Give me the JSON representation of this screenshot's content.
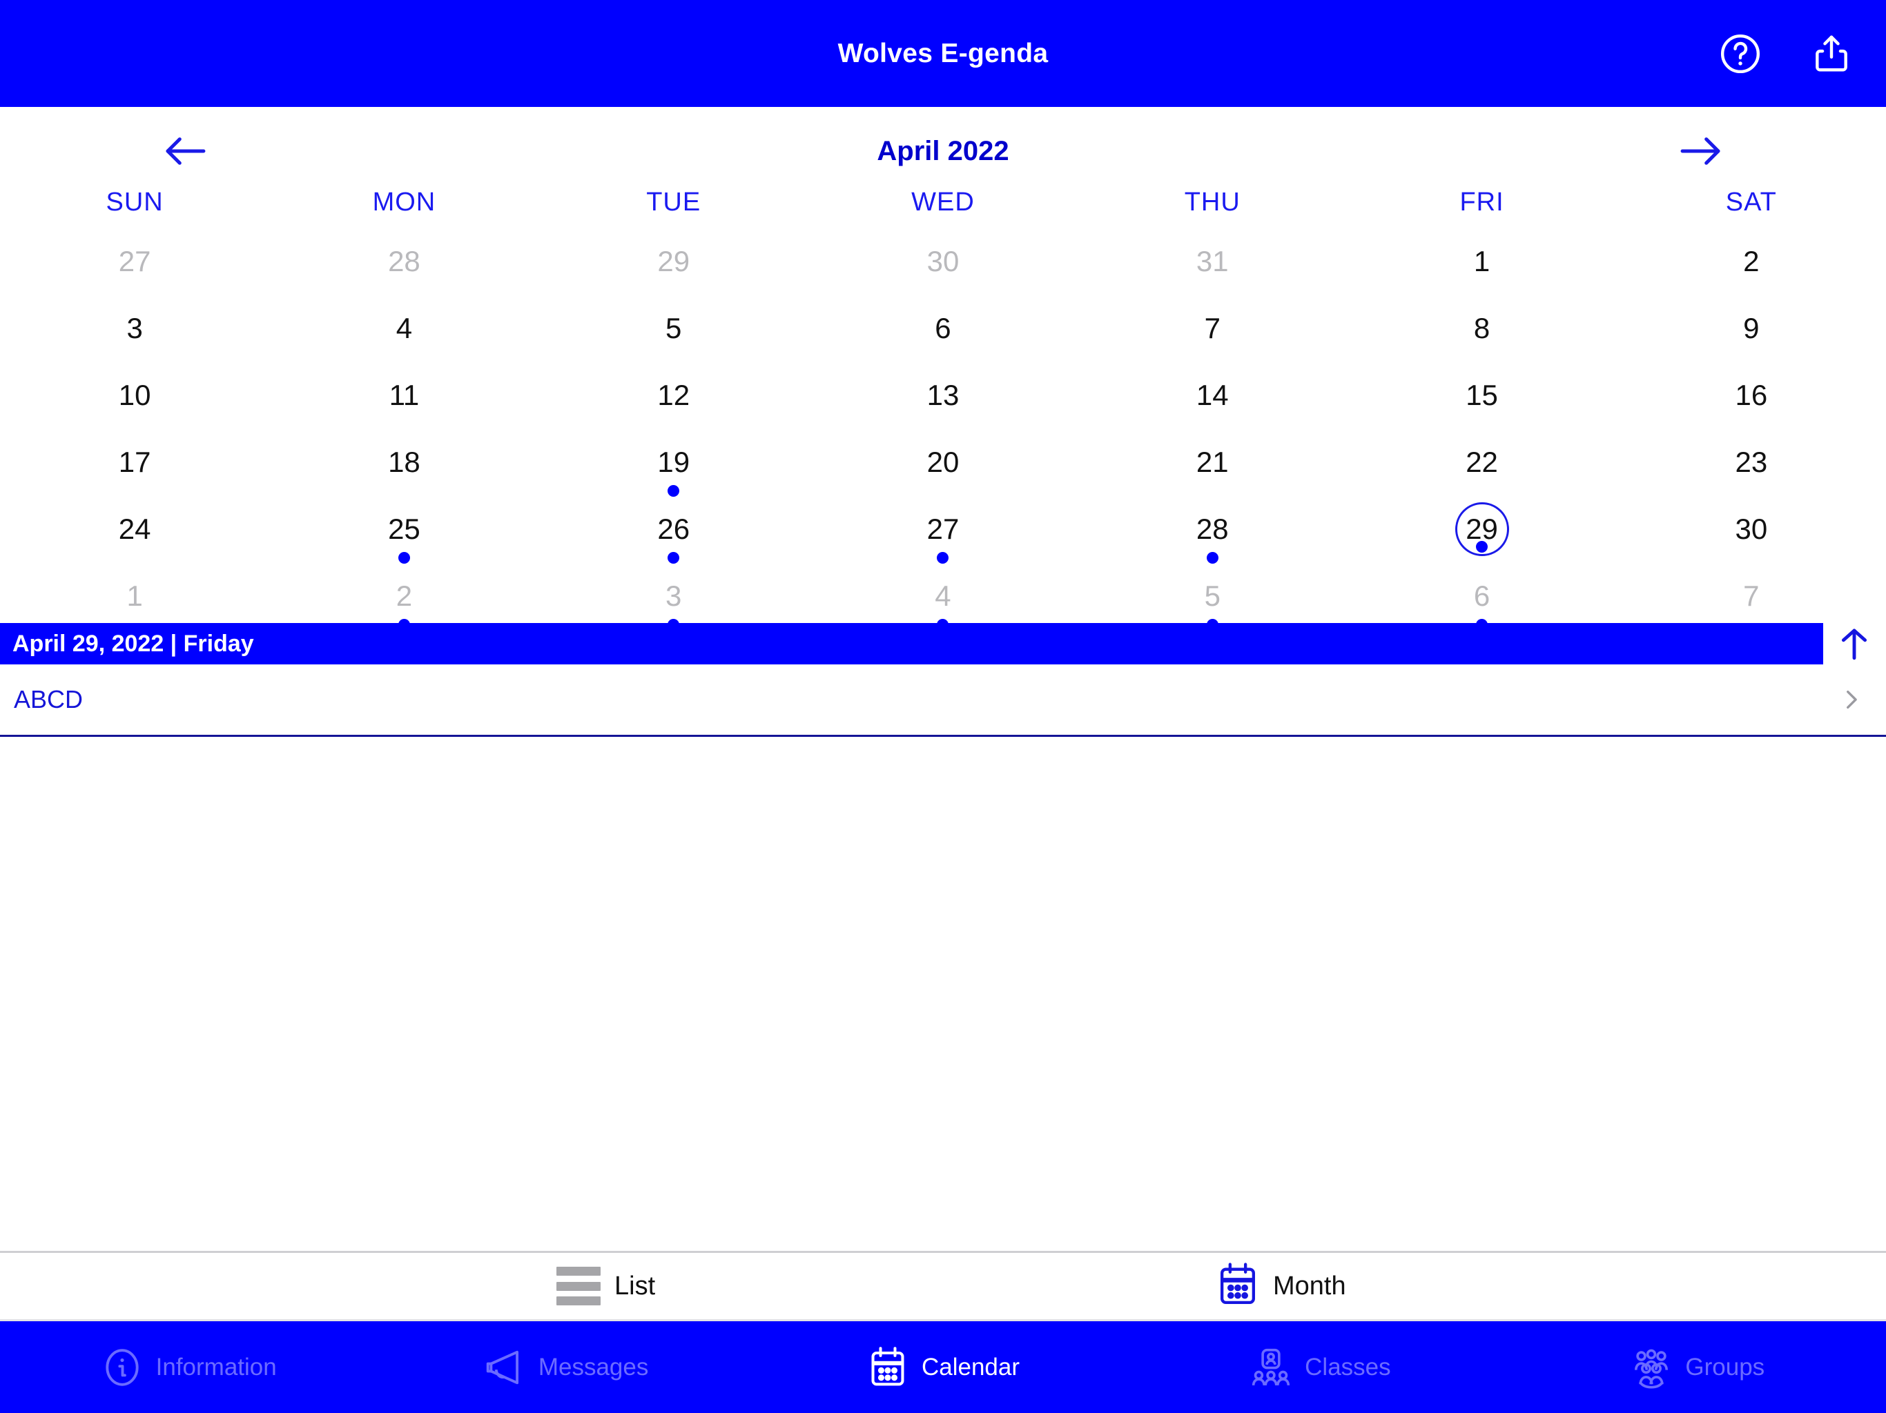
{
  "header": {
    "title": "Wolves E-genda",
    "help_icon": "help-circle-icon",
    "share_icon": "share-icon"
  },
  "calendar": {
    "month_label": "April 2022",
    "prev_icon": "arrow-left-icon",
    "next_icon": "arrow-right-icon",
    "weekdays": [
      "SUN",
      "MON",
      "TUE",
      "WED",
      "THU",
      "FRI",
      "SAT"
    ],
    "days": [
      {
        "num": "27",
        "muted": true,
        "dot": false,
        "selected": false
      },
      {
        "num": "28",
        "muted": true,
        "dot": false,
        "selected": false
      },
      {
        "num": "29",
        "muted": true,
        "dot": false,
        "selected": false
      },
      {
        "num": "30",
        "muted": true,
        "dot": false,
        "selected": false
      },
      {
        "num": "31",
        "muted": true,
        "dot": false,
        "selected": false
      },
      {
        "num": "1",
        "muted": false,
        "dot": false,
        "selected": false
      },
      {
        "num": "2",
        "muted": false,
        "dot": false,
        "selected": false
      },
      {
        "num": "3",
        "muted": false,
        "dot": false,
        "selected": false
      },
      {
        "num": "4",
        "muted": false,
        "dot": false,
        "selected": false
      },
      {
        "num": "5",
        "muted": false,
        "dot": false,
        "selected": false
      },
      {
        "num": "6",
        "muted": false,
        "dot": false,
        "selected": false
      },
      {
        "num": "7",
        "muted": false,
        "dot": false,
        "selected": false
      },
      {
        "num": "8",
        "muted": false,
        "dot": false,
        "selected": false
      },
      {
        "num": "9",
        "muted": false,
        "dot": false,
        "selected": false
      },
      {
        "num": "10",
        "muted": false,
        "dot": false,
        "selected": false
      },
      {
        "num": "11",
        "muted": false,
        "dot": false,
        "selected": false
      },
      {
        "num": "12",
        "muted": false,
        "dot": false,
        "selected": false
      },
      {
        "num": "13",
        "muted": false,
        "dot": false,
        "selected": false
      },
      {
        "num": "14",
        "muted": false,
        "dot": false,
        "selected": false
      },
      {
        "num": "15",
        "muted": false,
        "dot": false,
        "selected": false
      },
      {
        "num": "16",
        "muted": false,
        "dot": false,
        "selected": false
      },
      {
        "num": "17",
        "muted": false,
        "dot": false,
        "selected": false
      },
      {
        "num": "18",
        "muted": false,
        "dot": false,
        "selected": false
      },
      {
        "num": "19",
        "muted": false,
        "dot": true,
        "selected": false
      },
      {
        "num": "20",
        "muted": false,
        "dot": false,
        "selected": false
      },
      {
        "num": "21",
        "muted": false,
        "dot": false,
        "selected": false
      },
      {
        "num": "22",
        "muted": false,
        "dot": false,
        "selected": false
      },
      {
        "num": "23",
        "muted": false,
        "dot": false,
        "selected": false
      },
      {
        "num": "24",
        "muted": false,
        "dot": false,
        "selected": false
      },
      {
        "num": "25",
        "muted": false,
        "dot": true,
        "selected": false
      },
      {
        "num": "26",
        "muted": false,
        "dot": true,
        "selected": false
      },
      {
        "num": "27",
        "muted": false,
        "dot": true,
        "selected": false
      },
      {
        "num": "28",
        "muted": false,
        "dot": true,
        "selected": false
      },
      {
        "num": "29",
        "muted": false,
        "dot": true,
        "selected": true
      },
      {
        "num": "30",
        "muted": false,
        "dot": false,
        "selected": false
      },
      {
        "num": "1",
        "muted": true,
        "dot": false,
        "selected": false
      },
      {
        "num": "2",
        "muted": true,
        "dot": true,
        "selected": false
      },
      {
        "num": "3",
        "muted": true,
        "dot": true,
        "selected": false
      },
      {
        "num": "4",
        "muted": true,
        "dot": true,
        "selected": false
      },
      {
        "num": "5",
        "muted": true,
        "dot": true,
        "selected": false
      },
      {
        "num": "6",
        "muted": true,
        "dot": true,
        "selected": false
      },
      {
        "num": "7",
        "muted": true,
        "dot": false,
        "selected": false
      }
    ]
  },
  "selected_day_bar": {
    "label": "April 29, 2022 | Friday",
    "collapse_icon": "arrow-up-icon"
  },
  "events": [
    {
      "title": "ABCD",
      "chevron": "chevron-right-icon"
    }
  ],
  "view_switch": {
    "tabs": [
      {
        "label": "List",
        "icon": "list-icon",
        "active": false
      },
      {
        "label": "Month",
        "icon": "calendar-icon",
        "active": true
      }
    ]
  },
  "tabbar": {
    "items": [
      {
        "label": "Information",
        "icon": "info-circle-icon",
        "active": false
      },
      {
        "label": "Messages",
        "icon": "megaphone-icon",
        "active": false
      },
      {
        "label": "Calendar",
        "icon": "calendar-icon",
        "active": true
      },
      {
        "label": "Classes",
        "icon": "classes-icon",
        "active": false
      },
      {
        "label": "Groups",
        "icon": "groups-icon",
        "active": false
      }
    ]
  },
  "colors": {
    "brand_blue": "#0000FF",
    "accent_blue": "#1A1AE8",
    "muted_gray": "#B9B9BC",
    "day_text": "#111111"
  }
}
